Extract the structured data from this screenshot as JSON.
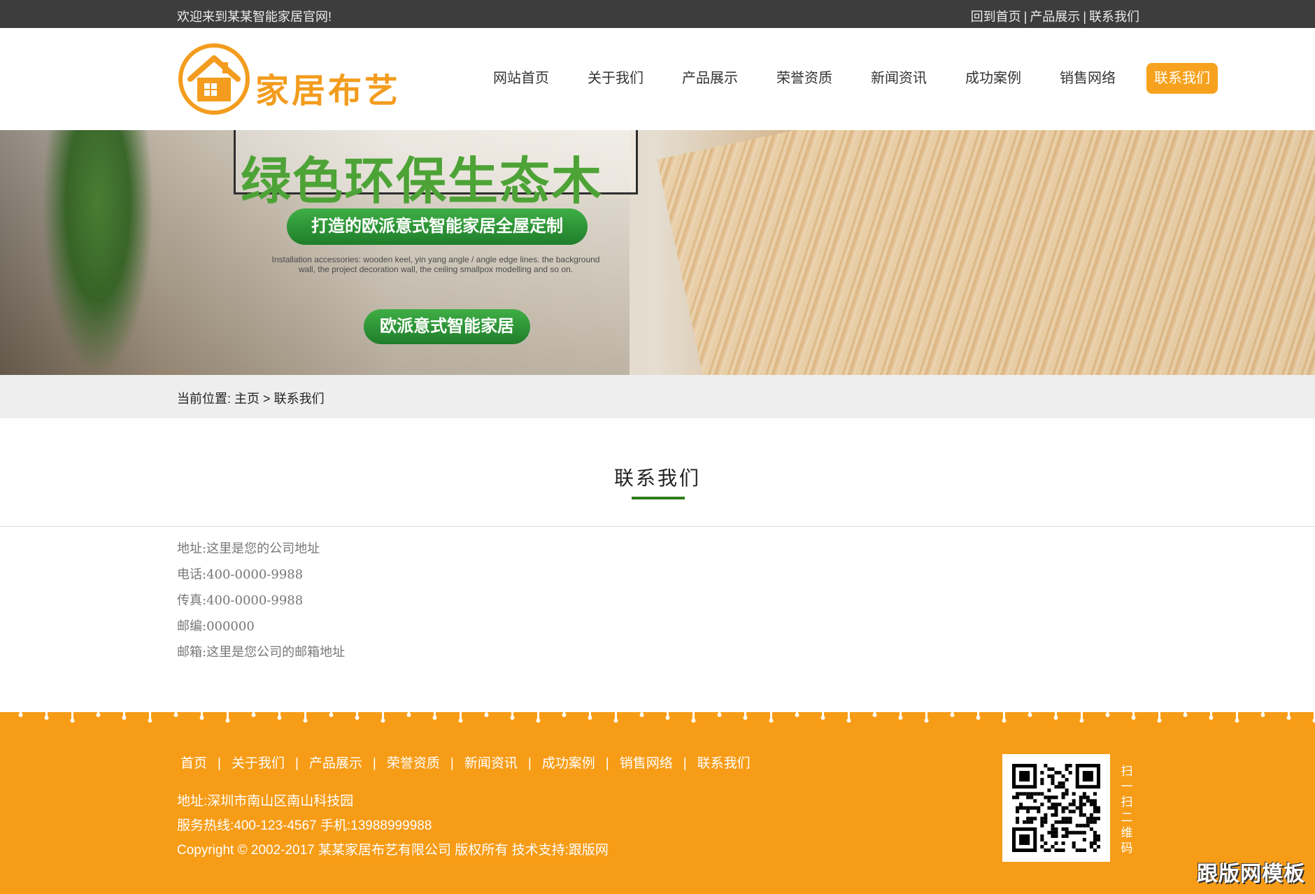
{
  "topbar": {
    "welcome": "欢迎来到某某智能家居官网!",
    "links": [
      "回到首页",
      "产品展示",
      "联系我们"
    ],
    "separator": "|"
  },
  "header": {
    "logo_text": "家居布艺",
    "nav": [
      "网站首页",
      "关于我们",
      "产品展示",
      "荣誉资质",
      "新闻资讯",
      "成功案例",
      "销售网络",
      "联系我们"
    ],
    "active_index": 7
  },
  "banner": {
    "headline": "绿色环保生态木",
    "pill_primary": "打造的欧派意式智能家居全屋定制",
    "description": "Installation accessories: wooden keel, yin yang angle / angle edge lines. the background wall, the project decoration wall, the ceiling smallpox modelling and so on.",
    "pill_secondary": "欧派意式智能家居"
  },
  "breadcrumb": {
    "label": "当前位置:",
    "home": "主页",
    "separator": ">",
    "current": "联系我们"
  },
  "contact": {
    "title": "联系我们",
    "rows": [
      "地址:这里是您的公司地址",
      "电话:400-0000-9988",
      "传真:400-0000-9988",
      "邮编:000000",
      "邮箱:这里是您公司的邮箱地址"
    ]
  },
  "footer": {
    "nav": [
      "首页",
      "关于我们",
      "产品展示",
      "荣誉资质",
      "新闻资讯",
      "成功案例",
      "销售网络",
      "联系我们"
    ],
    "nav_separator": "|",
    "address": "地址:深圳市南山区南山科技园",
    "hotline": "服务热线:400-123-4567 手机:13988999988",
    "copyright": "Copyright © 2002-2017 某某家居布艺有限公司 版权所有 技术支持:跟版网",
    "qr_caption": "扫一扫二维码",
    "watermark": "跟版网模板"
  },
  "colors": {
    "accent_orange": "#f7a21e",
    "footer_orange": "#f79c16",
    "title_green": "#2f7d1c",
    "topbar_dark": "#3d3d3d"
  }
}
